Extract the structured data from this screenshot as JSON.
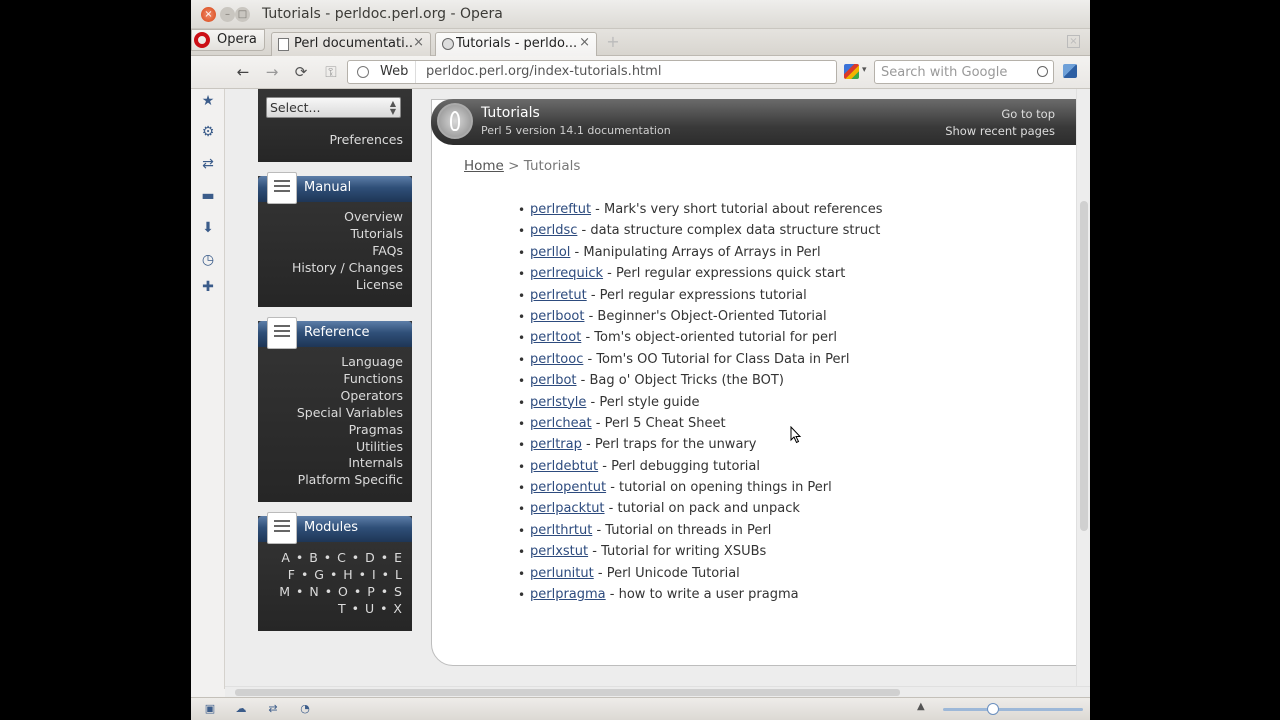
{
  "window": {
    "title": "Tutorials - perldoc.perl.org - Opera",
    "close": "×",
    "minimize": "–",
    "maximize": "□"
  },
  "tabbar": {
    "menu_label": "Opera",
    "tabs": [
      {
        "label": "Perl documentati...",
        "active": false
      },
      {
        "label": "Tutorials - perldo...",
        "active": true
      }
    ],
    "tab_close": "×",
    "new_tab": "+",
    "close_all": "×"
  },
  "toolbar": {
    "back": "←",
    "forward": "→",
    "reload": "⟳",
    "key": "⚿",
    "web_label": "Web",
    "url": "perldoc.perl.org/index-tutorials.html",
    "search_placeholder": "Search with Google",
    "caret": "▾"
  },
  "sidepanel": {
    "icons": [
      "bookmarks-icon",
      "settings-icon",
      "share-icon",
      "notes-icon",
      "downloads-icon",
      "history-icon",
      "add-panel-icon"
    ],
    "glyphs": [
      "★",
      "⚙",
      "⇄",
      "▬",
      "⬇",
      "◷",
      "✚"
    ]
  },
  "statusbar": {
    "glyphs": [
      "▣",
      "☁",
      "⇄",
      "◔"
    ],
    "zoom_caret": "▲"
  },
  "perldoc_nav": {
    "select_label": "Select...",
    "preferences": "Preferences",
    "manual": {
      "title": "Manual",
      "links": [
        "Overview",
        "Tutorials",
        "FAQs",
        "History / Changes",
        "License"
      ]
    },
    "reference": {
      "title": "Reference",
      "links": [
        "Language",
        "Functions",
        "Operators",
        "Special Variables",
        "Pragmas",
        "Utilities",
        "Internals",
        "Platform Specific"
      ]
    },
    "modules": {
      "title": "Modules",
      "links": [
        "A • B • C • D • E",
        "F • G • H • I • L",
        "M • N • O • P • S",
        "T • U • X"
      ]
    }
  },
  "content": {
    "title": "Tutorials",
    "subtitle": "Perl 5 version 14.1 documentation",
    "go_to_top": "Go to top",
    "show_recent": "Show recent pages",
    "breadcrumb_home": "Home",
    "breadcrumb_sep": " > ",
    "breadcrumb_current": "Tutorials",
    "tutorials": [
      {
        "link": "perlreftut",
        "desc": " - Mark's very short tutorial about references"
      },
      {
        "link": "perldsc",
        "desc": " - data structure complex data structure struct"
      },
      {
        "link": "perllol",
        "desc": " - Manipulating Arrays of Arrays in Perl"
      },
      {
        "link": "perlrequick",
        "desc": " - Perl regular expressions quick start"
      },
      {
        "link": "perlretut",
        "desc": " - Perl regular expressions tutorial"
      },
      {
        "link": "perlboot",
        "desc": " - Beginner's Object-Oriented Tutorial"
      },
      {
        "link": "perltoot",
        "desc": " - Tom's object-oriented tutorial for perl"
      },
      {
        "link": "perltooc",
        "desc": " - Tom's OO Tutorial for Class Data in Perl"
      },
      {
        "link": "perlbot",
        "desc": " - Bag o' Object Tricks (the BOT)"
      },
      {
        "link": "perlstyle",
        "desc": " - Perl style guide"
      },
      {
        "link": "perlcheat",
        "desc": " - Perl 5 Cheat Sheet"
      },
      {
        "link": "perltrap",
        "desc": " - Perl traps for the unwary"
      },
      {
        "link": "perldebtut",
        "desc": " - Perl debugging tutorial"
      },
      {
        "link": "perlopentut",
        "desc": " - tutorial on opening things in Perl"
      },
      {
        "link": "perlpacktut",
        "desc": " - tutorial on pack and unpack"
      },
      {
        "link": "perlthrtut",
        "desc": " - Tutorial on threads in Perl"
      },
      {
        "link": "perlxstut",
        "desc": " - Tutorial for writing XSUBs"
      },
      {
        "link": "perlunitut",
        "desc": " - Perl Unicode Tutorial"
      },
      {
        "link": "perlpragma",
        "desc": " - how to write a user pragma"
      }
    ]
  }
}
